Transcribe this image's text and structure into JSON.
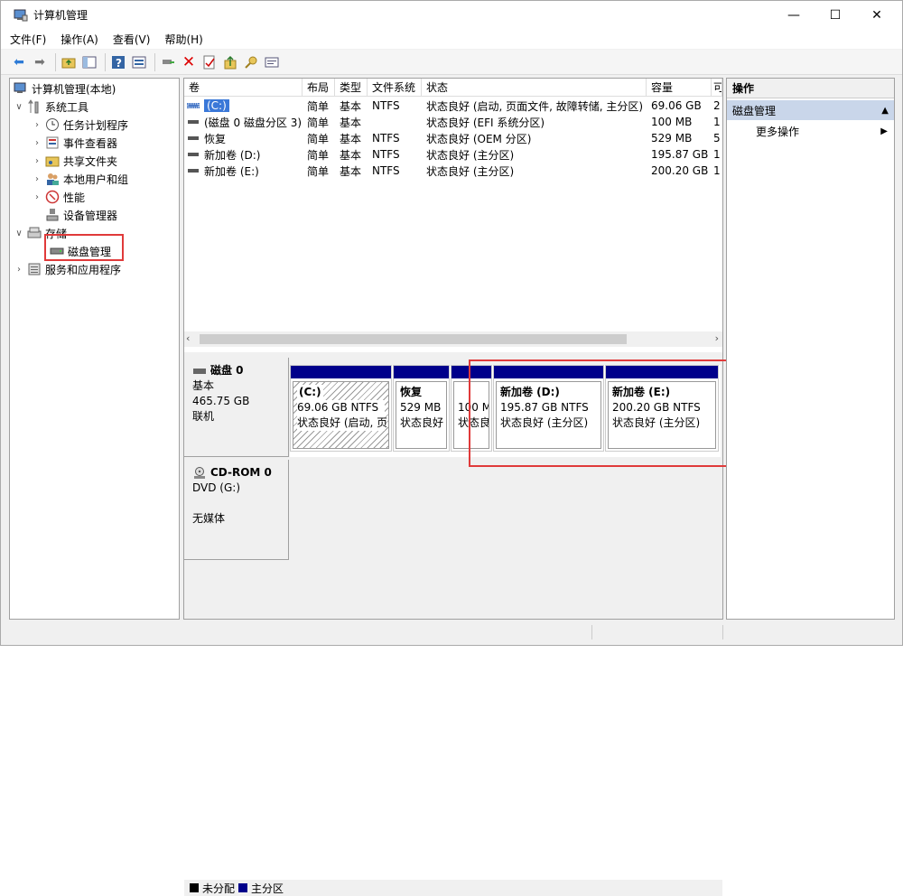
{
  "window": {
    "title": "计算机管理",
    "minimize": "—",
    "maximize": "☐",
    "close": "✕"
  },
  "menu": [
    "文件(F)",
    "操作(A)",
    "查看(V)",
    "帮助(H)"
  ],
  "tree": {
    "root": "计算机管理(本地)",
    "system_tools": "系统工具",
    "task_scheduler": "任务计划程序",
    "event_viewer": "事件查看器",
    "shared_folders": "共享文件夹",
    "local_users": "本地用户和组",
    "performance": "性能",
    "device_manager": "设备管理器",
    "storage": "存储",
    "disk_management": "磁盘管理",
    "services_apps": "服务和应用程序"
  },
  "volume_table": {
    "headers": [
      "卷",
      "布局",
      "类型",
      "文件系统",
      "状态",
      "容量",
      "可"
    ],
    "rows": [
      {
        "vol": "(C:)",
        "layout": "简单",
        "type": "基本",
        "fs": "NTFS",
        "status": "状态良好 (启动, 页面文件, 故障转储, 主分区)",
        "cap": "69.06 GB",
        "free": "2"
      },
      {
        "vol": "(磁盘 0 磁盘分区 3)",
        "layout": "简单",
        "type": "基本",
        "fs": "",
        "status": "状态良好 (EFI 系统分区)",
        "cap": "100 MB",
        "free": "1"
      },
      {
        "vol": "恢复",
        "layout": "简单",
        "type": "基本",
        "fs": "NTFS",
        "status": "状态良好 (OEM 分区)",
        "cap": "529 MB",
        "free": "5"
      },
      {
        "vol": "新加卷 (D:)",
        "layout": "简单",
        "type": "基本",
        "fs": "NTFS",
        "status": "状态良好 (主分区)",
        "cap": "195.87 GB",
        "free": "1"
      },
      {
        "vol": "新加卷 (E:)",
        "layout": "简单",
        "type": "基本",
        "fs": "NTFS",
        "status": "状态良好 (主分区)",
        "cap": "200.20 GB",
        "free": "1"
      }
    ]
  },
  "disk0": {
    "name": "磁盘 0",
    "type": "基本",
    "size": "465.75 GB",
    "state": "联机",
    "partitions": [
      {
        "title": "(C:)",
        "size": "69.06 GB NTFS",
        "status": "状态良好 (启动, 页"
      },
      {
        "title": "恢复",
        "size": "529 MB",
        "status": "状态良好"
      },
      {
        "title": "",
        "size": "100 M",
        "status": "状态良"
      },
      {
        "title": "新加卷  (D:)",
        "size": "195.87 GB NTFS",
        "status": "状态良好 (主分区)"
      },
      {
        "title": "新加卷  (E:)",
        "size": "200.20 GB NTFS",
        "status": "状态良好 (主分区)"
      }
    ]
  },
  "cdrom": {
    "name": "CD-ROM 0",
    "drive": "DVD (G:)",
    "media": "无媒体"
  },
  "legend": {
    "unallocated": "未分配",
    "primary": "主分区"
  },
  "actions": {
    "header": "操作",
    "selected": "磁盘管理",
    "more": "更多操作"
  },
  "colors": {
    "primary_partition": "#00008b",
    "unallocated": "#000000",
    "highlight": "#e03a3a",
    "selection": "#c9d6ea"
  }
}
